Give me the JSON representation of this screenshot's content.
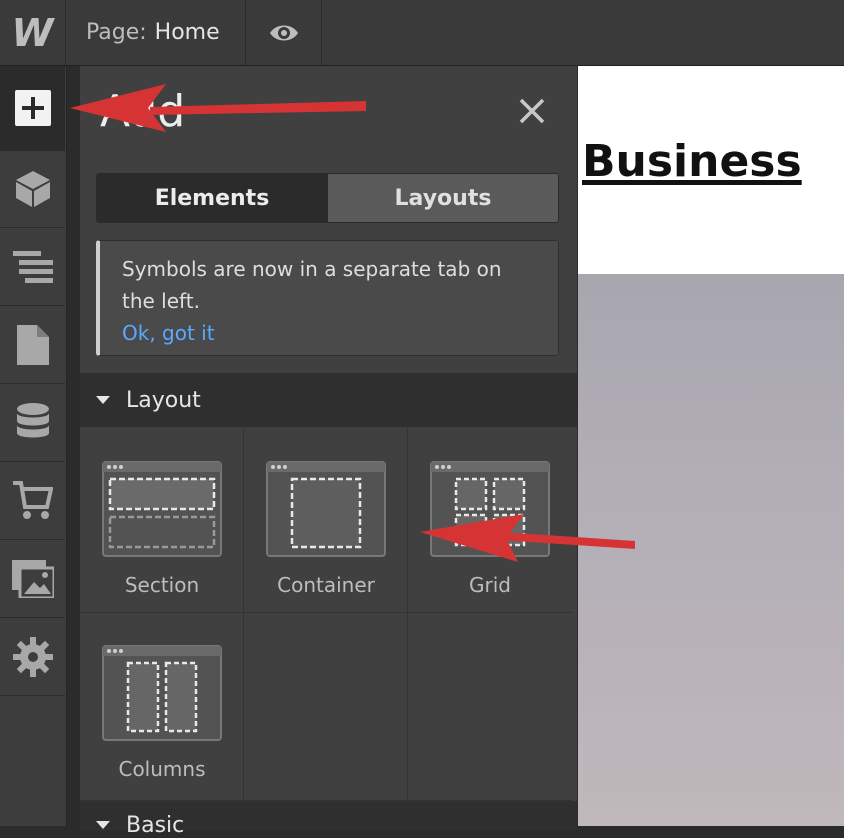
{
  "topbar": {
    "logo_letter": "W",
    "page_label": "Page:",
    "page_value": "Home"
  },
  "sidebar": {
    "items": [
      {
        "name": "add-panel",
        "icon": "plus-icon"
      },
      {
        "name": "symbols",
        "icon": "cube-icon"
      },
      {
        "name": "navigator",
        "icon": "navigator-icon"
      },
      {
        "name": "pages",
        "icon": "page-icon"
      },
      {
        "name": "cms",
        "icon": "database-icon"
      },
      {
        "name": "ecommerce",
        "icon": "cart-icon"
      },
      {
        "name": "assets",
        "icon": "images-icon"
      },
      {
        "name": "settings",
        "icon": "gear-icon"
      }
    ]
  },
  "panel": {
    "title": "Add",
    "tabs": [
      {
        "label": "Elements",
        "selected": true
      },
      {
        "label": "Layouts",
        "selected": false
      }
    ],
    "notice": {
      "text": "Symbols are now in a separate tab on the left.",
      "link": "Ok, got it"
    },
    "layout_section": {
      "title": "Layout",
      "items": [
        {
          "label": "Section",
          "icon": "section-icon"
        },
        {
          "label": "Container",
          "icon": "container-icon"
        },
        {
          "label": "Grid",
          "icon": "grid-icon"
        },
        {
          "label": "Columns",
          "icon": "columns-icon"
        }
      ]
    },
    "basic_section": {
      "title": "Basic"
    }
  },
  "canvas": {
    "brand_text": "Business"
  },
  "colors": {
    "link": "#5aa9ff",
    "annotation_arrow": "#d63434",
    "panel_bg": "#404040"
  }
}
